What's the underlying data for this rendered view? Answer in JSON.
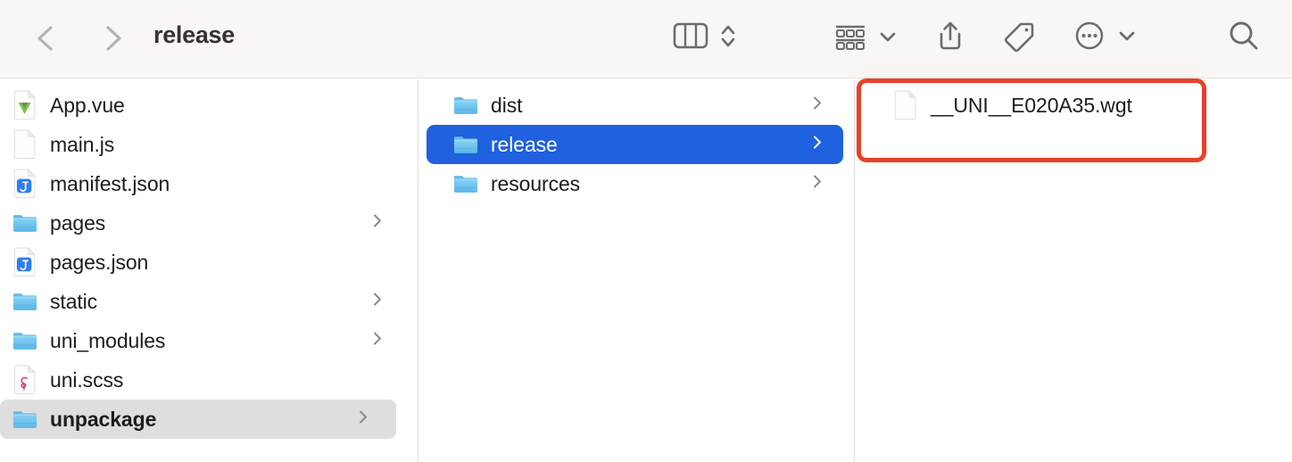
{
  "window": {
    "title": "release"
  },
  "toolbar": {
    "back_label": "Back",
    "forward_label": "Forward",
    "view_mode_label": "Column View",
    "view_mode_icon": "column-view-icon",
    "view_stepper_icon": "chevron-up-down-icon",
    "group_label": "Group",
    "group_icon": "group-items-icon",
    "group_chevron_icon": "chevron-down-icon",
    "share_label": "Share",
    "share_icon": "share-icon",
    "tag_label": "Tags",
    "tag_icon": "tag-icon",
    "more_label": "More",
    "more_icon": "ellipsis-circle-icon",
    "more_chevron_icon": "chevron-down-icon",
    "search_label": "Search",
    "search_icon": "search-icon"
  },
  "colors": {
    "accent_selection": "#1f61de",
    "inactive_selection": "#dedede",
    "annotation_red": "#e8402a",
    "toolbar_bg": "#f9f6f5",
    "folder_blue": "#6fc3f0"
  },
  "annotation": {
    "shape": "rectangle",
    "color": "#e8402a",
    "target": "__UNI__E020A35.wgt"
  },
  "columns": [
    {
      "name": "column-1",
      "items": [
        {
          "label": "App.vue",
          "icon": "vue-file-icon",
          "kind": "file",
          "disclosure": false,
          "state": "normal"
        },
        {
          "label": "main.js",
          "icon": "blank-file-icon",
          "kind": "file",
          "disclosure": false,
          "state": "normal"
        },
        {
          "label": "manifest.json",
          "icon": "json-file-icon",
          "kind": "file",
          "disclosure": false,
          "state": "normal"
        },
        {
          "label": "pages",
          "icon": "folder-icon",
          "kind": "folder",
          "disclosure": true,
          "state": "normal"
        },
        {
          "label": "pages.json",
          "icon": "json-file-icon",
          "kind": "file",
          "disclosure": false,
          "state": "normal"
        },
        {
          "label": "static",
          "icon": "folder-icon",
          "kind": "folder",
          "disclosure": true,
          "state": "normal"
        },
        {
          "label": "uni_modules",
          "icon": "folder-icon",
          "kind": "folder",
          "disclosure": true,
          "state": "normal"
        },
        {
          "label": "uni.scss",
          "icon": "scss-file-icon",
          "kind": "file",
          "disclosure": false,
          "state": "normal"
        },
        {
          "label": "unpackage",
          "icon": "folder-icon",
          "kind": "folder",
          "disclosure": true,
          "state": "selected-inactive"
        }
      ]
    },
    {
      "name": "column-2",
      "items": [
        {
          "label": "dist",
          "icon": "folder-icon",
          "kind": "folder",
          "disclosure": true,
          "state": "normal"
        },
        {
          "label": "release",
          "icon": "folder-icon",
          "kind": "folder",
          "disclosure": true,
          "state": "selected-active"
        },
        {
          "label": "resources",
          "icon": "folder-icon",
          "kind": "folder",
          "disclosure": true,
          "state": "normal"
        }
      ]
    },
    {
      "name": "column-3",
      "items": [
        {
          "label": "__UNI__E020A35.wgt",
          "icon": "blank-file-icon",
          "kind": "file",
          "disclosure": false,
          "state": "normal"
        }
      ]
    }
  ]
}
